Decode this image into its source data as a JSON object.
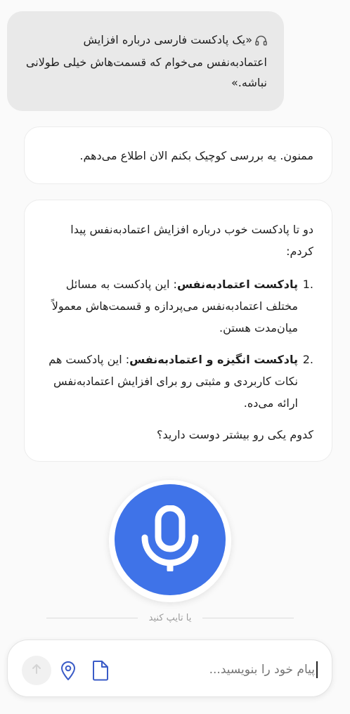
{
  "user_message": {
    "icon": "headphones-icon",
    "text": "«یک پادکست فارسی درباره افزایش اعتمادبه‌نفس می‌خوام که قسمت‌هاش خیلی طولانی نباشه.»"
  },
  "assistant_ack": {
    "text": "ممنون. یه بررسی کوچیک بکنم الان اطلاع می‌دهم."
  },
  "assistant_reply": {
    "intro": "دو تا پادکست خوب درباره افزایش اعتمادبه‌نفس پیدا کردم:",
    "items": [
      {
        "number": "1.",
        "title": "پادکست اعتمادبه‌نفس",
        "description": ": این پادکست به مسائل مختلف اعتمادبه‌نفس می‌پردازه و قسمت‌هاش معمولاً میان‌مدت هستن."
      },
      {
        "number": "2.",
        "title": "پادکست انگیزه و اعتمادبه‌نفس",
        "description": ": این پادکست هم نکات کاربردی و مثبتی رو برای افزایش اعتمادبه‌نفس ارائه می‌ده."
      }
    ],
    "question": "کدوم یکی رو بیشتر دوست دارید؟"
  },
  "voice": {
    "icon": "microphone-icon",
    "accent_color": "#3f73e8",
    "or_type_label": "یا تایپ کنید"
  },
  "composer": {
    "placeholder": "پیام خود را بنویسید...",
    "send_icon": "arrow-up-icon",
    "location_icon": "location-pin-icon",
    "attach_icon": "file-icon"
  }
}
